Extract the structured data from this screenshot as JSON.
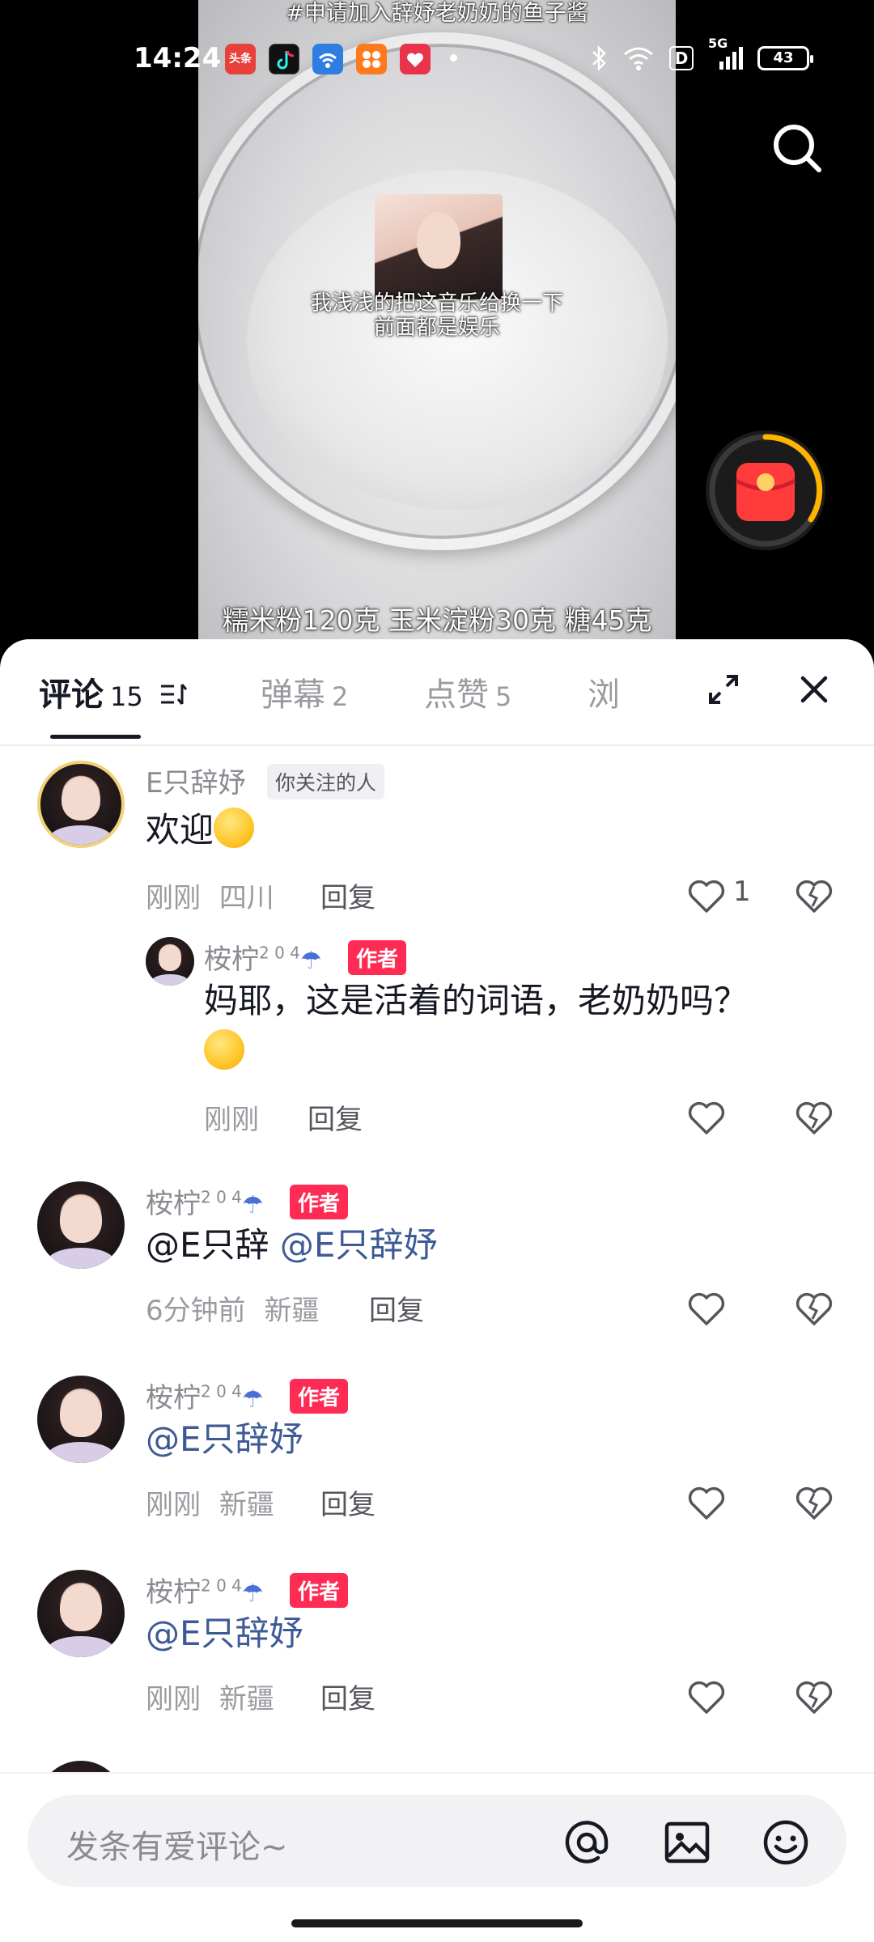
{
  "status_bar": {
    "time": "14:24",
    "network": "5G",
    "hd_label": "D",
    "battery": "43",
    "app_icons": [
      {
        "name": "toutiao-app-icon",
        "label": "头条",
        "color": "#e8413b"
      },
      {
        "name": "douyin-app-icon",
        "label": "",
        "color": "#111111"
      },
      {
        "name": "wifi-tool-app-icon",
        "label": "",
        "color": "#2f7de1"
      },
      {
        "name": "orange-app-icon",
        "label": "",
        "color": "#ff7a1a"
      },
      {
        "name": "red-heart-app-icon",
        "label": "",
        "color": "#e8334a"
      }
    ]
  },
  "video": {
    "caption_top": "#申请加入辞妤老奶奶的鱼子酱",
    "sticker_line1": "我浅浅的把这音乐给换一下",
    "sticker_line2": "前面都是娱乐",
    "caption_bottom": "糯米粉120克 玉米淀粉30克 糖45克"
  },
  "tabs": [
    {
      "label": "评论",
      "count": "15",
      "active": true
    },
    {
      "label": "弹幕",
      "count": "2",
      "active": false
    },
    {
      "label": "点赞",
      "count": "5",
      "active": false
    },
    {
      "label": "浏",
      "count": "",
      "active": false
    }
  ],
  "comments": [
    {
      "name": "E只辞妤",
      "badge": "你关注的人",
      "text": "欢迎",
      "time": "刚刚",
      "location": "四川",
      "reply_label": "回复",
      "like_count": "1"
    },
    {
      "name": "桉柠",
      "name_sup": "2 0 4",
      "badge": "作者",
      "text": "妈耶，这是活着的词语，老奶奶吗？",
      "time": "刚刚",
      "location": "",
      "reply_label": "回复"
    },
    {
      "name": "桉柠",
      "name_sup": "2 0 4",
      "badge": "作者",
      "text": "@E只辞",
      "mention": "@E只辞妤",
      "time": "6分钟前",
      "location": "新疆",
      "reply_label": "回复"
    },
    {
      "name": "桉柠",
      "name_sup": "2 0 4",
      "badge": "作者",
      "mention": "@E只辞妤",
      "time": "刚刚",
      "location": "新疆",
      "reply_label": "回复"
    },
    {
      "name": "桉柠",
      "name_sup": "2 0 4",
      "badge": "作者",
      "mention": "@E只辞妤",
      "time": "刚刚",
      "location": "新疆",
      "reply_label": "回复"
    }
  ],
  "input": {
    "placeholder": "发条有爱评论~"
  },
  "colors": {
    "accent_red": "#fe2c55",
    "mention_blue": "#3d5a96",
    "redpacket_ring": "#ffb400"
  }
}
